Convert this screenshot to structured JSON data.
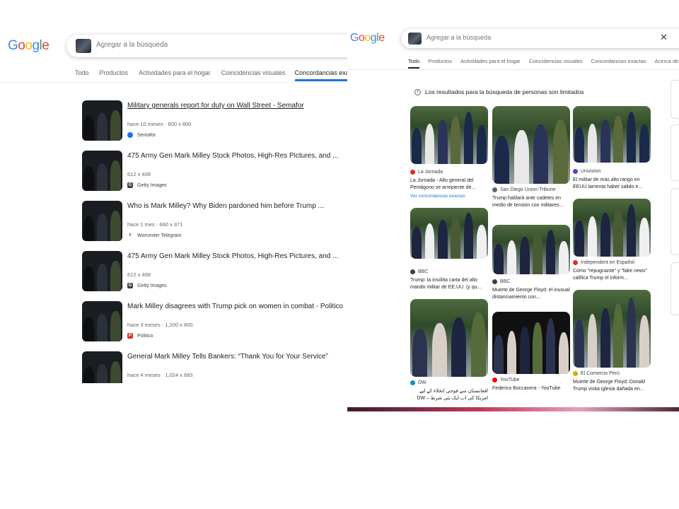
{
  "left": {
    "search": {
      "placeholder": "Agregar a la búsqueda"
    },
    "tabs": [
      {
        "label": "Todo",
        "active": false
      },
      {
        "label": "Productos",
        "active": false
      },
      {
        "label": "Actividades para el hogar",
        "active": false
      },
      {
        "label": "Coincidencias visuales",
        "active": false
      },
      {
        "label": "Concordancias exacta",
        "active": true
      }
    ],
    "results": [
      {
        "title": "Military generals report for duty on Wall Street - Semafor",
        "meta": "hace 10 meses · 800 x 600",
        "source": "Semafor",
        "favicon_color": "#1a73e8",
        "favicon_glyph": ""
      },
      {
        "title": "475 Army Gen Mark Milley Stock Photos, High-Res Pictures, and ...",
        "meta": "612 x 408",
        "source": "Getty Images",
        "favicon_color": "#3c4043",
        "favicon_glyph": "G"
      },
      {
        "title": "Who is Mark Milley? Why Biden pardoned him before Trump ...",
        "meta": "hace 1 mes · 660 x 371",
        "source": "Worcester Telegram",
        "favicon_color": "#ffffff",
        "favicon_glyph": "t"
      },
      {
        "title": "475 Army Gen Mark Milley Stock Photos, High-Res Pictures, and ...",
        "meta": "612 x 408",
        "source": "Getty Images",
        "favicon_color": "#3c4043",
        "favicon_glyph": "G"
      },
      {
        "title": "Mark Milley disagrees with Trump pick on women in combat - Politico",
        "meta": "hace 3 meses · 1,200 x 800",
        "source": "Politico",
        "favicon_color": "#d93025",
        "favicon_glyph": "P"
      },
      {
        "title": "General Mark Milley Tells Bankers: “Thank You for Your Service”",
        "meta": "hace 4 meses · 1,024 x 683",
        "source": "",
        "favicon_color": "#3c4043",
        "favicon_glyph": ""
      }
    ]
  },
  "right": {
    "search": {
      "placeholder": "Agregar a la búsqueda"
    },
    "tabs": [
      {
        "label": "Todo",
        "active": true
      },
      {
        "label": "Productos",
        "active": false
      },
      {
        "label": "Actividades para el hogar",
        "active": false
      },
      {
        "label": "Coincidencias visuales",
        "active": false
      },
      {
        "label": "Concordancias exactas",
        "active": false
      },
      {
        "label": "Acerca de e",
        "active": false
      }
    ],
    "notice": "Los resultados para la búsqueda de personas son limitados",
    "cards": [
      {
        "source": "La Jornada",
        "title": "La Jornada - Alto general del Pentágono se arrepiente de...",
        "link": "Ver concordancias exactas",
        "icon": "#d93025"
      },
      {
        "source": "BBC",
        "title": "Trump: la insólita carta del alto mando militar de EE.UU. (y qu...",
        "link": "",
        "icon": "#3c4043"
      },
      {
        "source": "DW",
        "title": "افغانستان سے فوجی انخلاء کے لیے امریکا کی اب ایک نئی شرط – DW –...",
        "link": "",
        "icon": "#0a8fd8"
      },
      {
        "source": "San Diego Union-Tribune",
        "title": "Trump hablará ante cadetes en medio de tensión con militares...",
        "link": "",
        "icon": "#5f6368"
      },
      {
        "source": "BBC",
        "title": "Muerte de George Floyd: el inusual distanciamiento con...",
        "link": "",
        "icon": "#3c4043"
      },
      {
        "source": "YouTube",
        "title": "Federico Boccanera - YouTube",
        "link": "",
        "icon": "#ff0000"
      },
      {
        "source": "Univision",
        "title": "El militar de más alto rango en EEUU lamenta haber salido e...",
        "link": "",
        "icon": "#5b3fd1"
      },
      {
        "source": "Independent en Español",
        "title": "Cómo \"repugnante\" y \"fake news\" califica Trump el inform...",
        "link": "",
        "icon": "#d93025"
      },
      {
        "source": "El Comercio Perú",
        "title": "Muerte de George Floyd: Donald Trump visita iglesia dañada en...",
        "link": "",
        "icon": "#e0a800"
      }
    ]
  },
  "colors": {
    "accent": "#1a73e8",
    "google_blue": "#4285f4",
    "google_red": "#ea4335",
    "google_yellow": "#fbbc05",
    "google_green": "#34a853"
  },
  "logo": {
    "letters": [
      "G",
      "o",
      "o",
      "g",
      "l",
      "e"
    ]
  }
}
